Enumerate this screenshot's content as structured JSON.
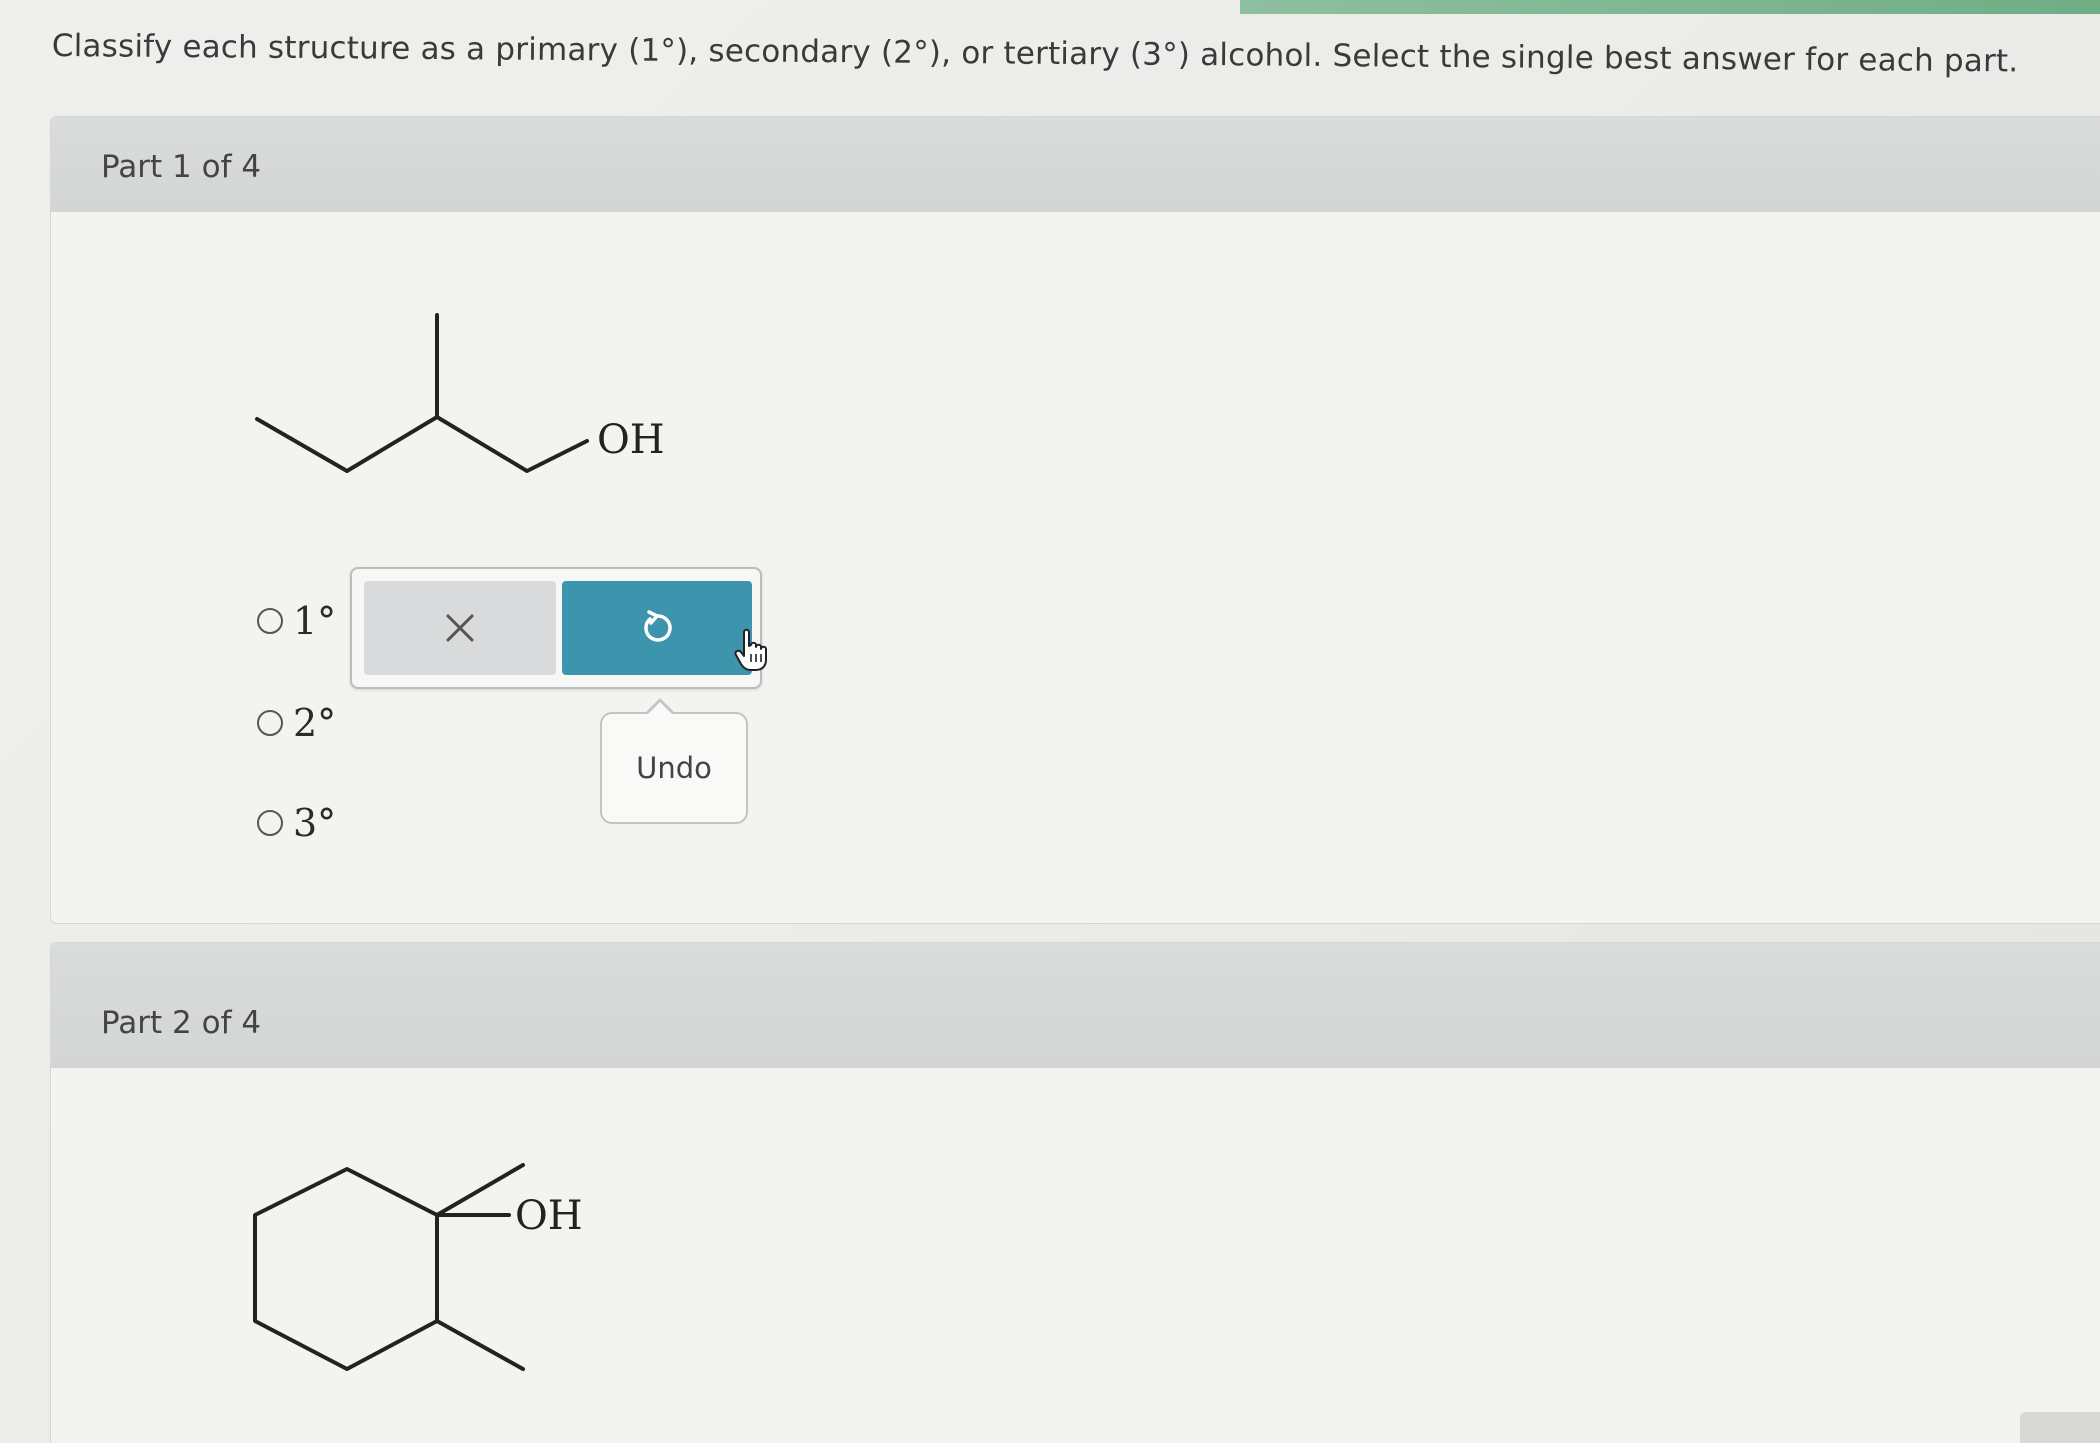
{
  "instructions": "Classify each structure as a primary (1°), secondary (2°), or tertiary (3°) alcohol. Select the single best answer for each part.",
  "parts": [
    {
      "title": "Part 1 of 4",
      "molecule_label": "OH",
      "options": [
        {
          "label": "1°"
        },
        {
          "label": "2°"
        },
        {
          "label": "3°"
        }
      ],
      "toolbar": {
        "clear_icon": "close-icon",
        "undo_icon": "undo-icon",
        "tooltip": "Undo"
      }
    },
    {
      "title": "Part 2 of 4",
      "molecule_label": "OH"
    }
  ],
  "colors": {
    "undo_button": "#3d94ad",
    "clear_button": "#d8dadb",
    "header_band": "#d6d9d7"
  }
}
